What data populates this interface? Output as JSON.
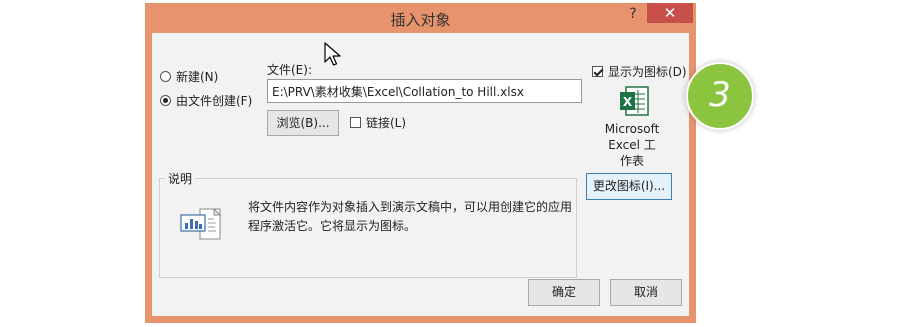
{
  "dialog": {
    "title": "插入对象",
    "help_label": "?",
    "close_label": "✕"
  },
  "options": {
    "create_new": "新建(N)",
    "create_from_file": "由文件创建(F)",
    "selected": "create_from_file"
  },
  "file": {
    "label": "文件(E):",
    "value": "E:\\PRV\\素材收集\\Excel\\Collation_to Hill.xlsx",
    "browse_label": "浏览(B)...",
    "link_label": "链接(L)",
    "link_checked": false
  },
  "display_as_icon": {
    "label": "显示为图标(D)",
    "checked": true,
    "icon_caption_line1": "Microsoft",
    "icon_caption_line2": "Excel 工",
    "icon_caption_line3": "作表",
    "change_icon_label": "更改图标(I)..."
  },
  "description": {
    "legend": "说明",
    "text_line1": "将文件内容作为对象插入到演示文稿中，可以用创建它的应用",
    "text_line2": "程序激活它。它将显示为图标。"
  },
  "buttons": {
    "ok": "确定",
    "cancel": "取消"
  },
  "step_badge": "3",
  "colors": {
    "frame": "#e7936e",
    "close": "#c7504a",
    "badge": "#8bc43f",
    "excel_green": "#1f7244"
  }
}
